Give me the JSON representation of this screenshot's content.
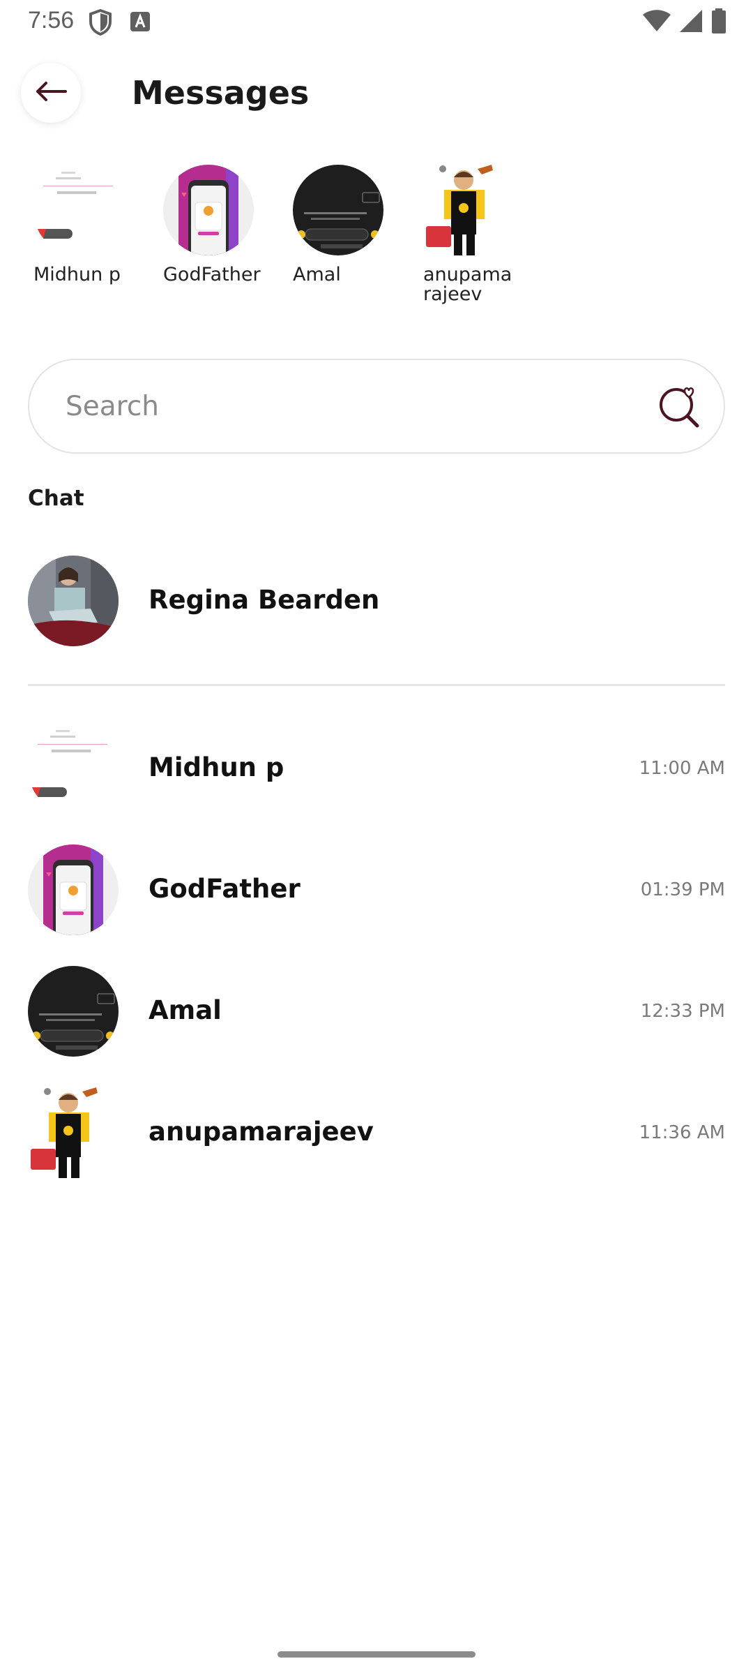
{
  "status_bar": {
    "time": "7:56",
    "icons": [
      "shield-icon",
      "a-notification-icon",
      "wifi-icon",
      "signal-icon",
      "battery-icon"
    ]
  },
  "header": {
    "title": "Messages",
    "back_icon": "arrow-left-icon"
  },
  "stories": [
    {
      "name": "Midhun p"
    },
    {
      "name": "GodFather"
    },
    {
      "name": "Amal"
    },
    {
      "name": "anupama rajeev"
    }
  ],
  "search": {
    "placeholder": "Search",
    "value": ""
  },
  "chat_section": {
    "label": "Chat"
  },
  "pinned_chat": {
    "name": "Regina Bearden"
  },
  "chats": [
    {
      "name": "Midhun p",
      "time": "11:00 AM"
    },
    {
      "name": "GodFather",
      "time": "01:39 PM"
    },
    {
      "name": "Amal",
      "time": "12:33 PM"
    },
    {
      "name": "anupamarajeev",
      "time": "11:36 AM"
    }
  ],
  "colors": {
    "accent": "#c2185b",
    "back_arrow": "#4a1420",
    "muted_text": "#7a7a7a"
  }
}
